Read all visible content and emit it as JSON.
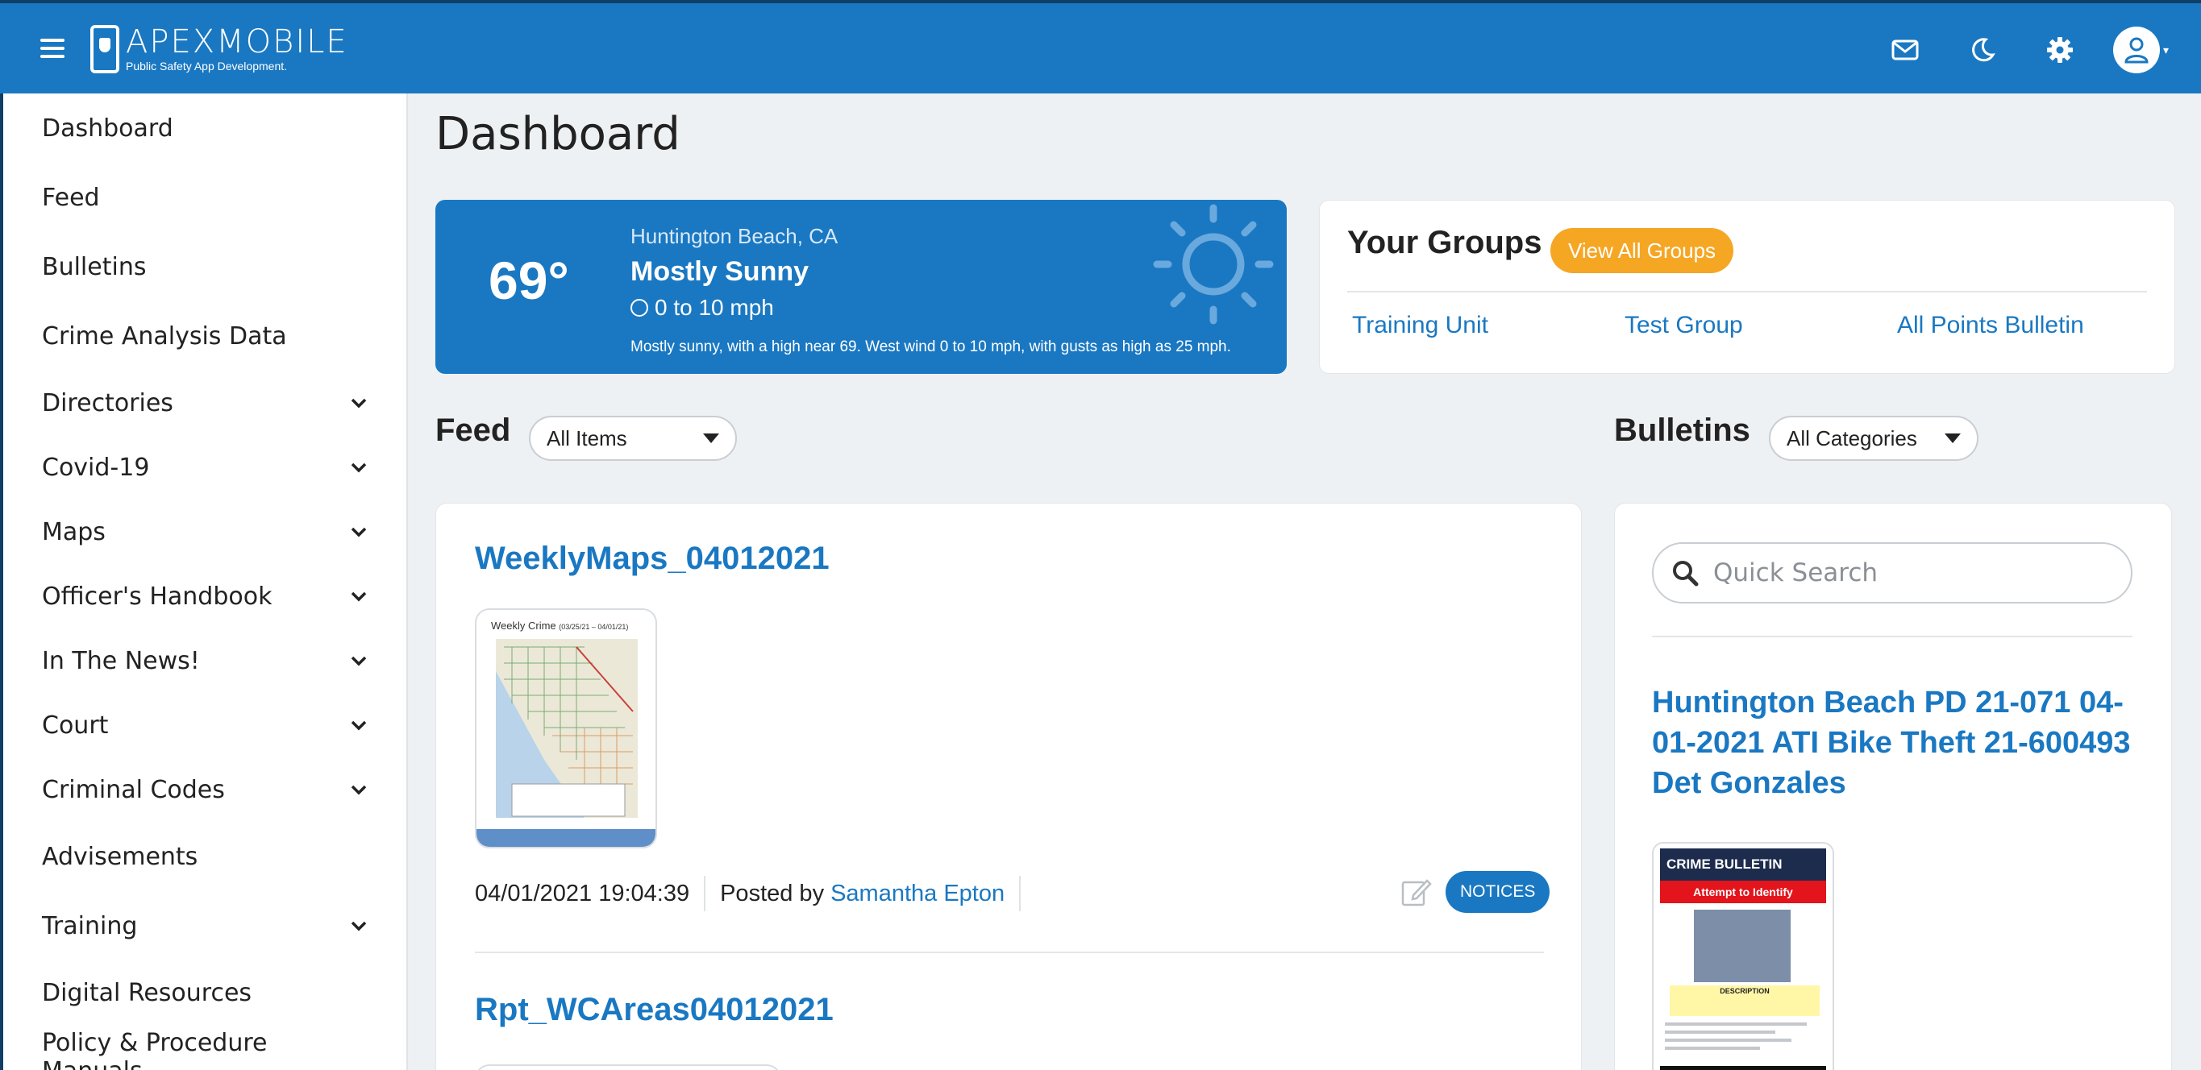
{
  "header": {
    "logo_name": "APEXMOBILE",
    "logo_tagline": "Public Safety App Development."
  },
  "sidebar": {
    "items": [
      {
        "label": "Dashboard",
        "expandable": false
      },
      {
        "label": "Feed",
        "expandable": false
      },
      {
        "label": "Bulletins",
        "expandable": false
      },
      {
        "label": "Crime Analysis Data",
        "expandable": false
      },
      {
        "label": "Directories",
        "expandable": true
      },
      {
        "label": "Covid-19",
        "expandable": true
      },
      {
        "label": "Maps",
        "expandable": true
      },
      {
        "label": "Officer's Handbook",
        "expandable": true
      },
      {
        "label": "In The News!",
        "expandable": true
      },
      {
        "label": "Court",
        "expandable": true
      },
      {
        "label": "Criminal Codes",
        "expandable": true
      },
      {
        "label": "Advisements",
        "expandable": false
      },
      {
        "label": "Training",
        "expandable": true
      },
      {
        "label": "Digital Resources",
        "expandable": false
      },
      {
        "label": "Policy & Procedure Manuals",
        "expandable": false
      }
    ]
  },
  "page": {
    "title": "Dashboard"
  },
  "weather": {
    "temperature": "69°",
    "location": "Huntington Beach, CA",
    "condition": "Mostly Sunny",
    "wind": "0 to 10 mph",
    "description": "Mostly sunny, with a high near 69. West wind 0 to 10 mph, with gusts as high as 25 mph."
  },
  "groups": {
    "title": "Your Groups",
    "view_all_label": "View All Groups",
    "links": [
      "Training Unit",
      "Test Group",
      "All Points Bulletin"
    ]
  },
  "feed": {
    "label": "Feed",
    "filter_value": "All Items",
    "posts": [
      {
        "title": "WeeklyMaps_04012021",
        "thumb_title": "Weekly Crime",
        "thumb_range": "(03/25/21 – 04/01/21)",
        "timestamp": "04/01/2021 19:04:39",
        "posted_by_label": "Posted by",
        "author": "Samantha Epton",
        "tag": "NOTICES"
      },
      {
        "title": "Rpt_WCAreas04012021"
      }
    ]
  },
  "bulletins": {
    "label": "Bulletins",
    "filter_value": "All Categories",
    "search_placeholder": "Quick Search",
    "item": {
      "title": "Huntington Beach PD 21-071 04-01-2021 ATI Bike Theft 21-600493 Det Gonzales",
      "thumb_header": "CRIME BULLETIN",
      "thumb_banner": "Attempt to Identify",
      "thumb_desc": "DESCRIPTION"
    }
  },
  "colors": {
    "brand_blue": "#1a78c2",
    "accent_orange": "#f5a623",
    "background": "#eef1f3"
  },
  "icons": {
    "menu": "hamburger-icon",
    "mail": "mail-icon",
    "theme": "moon-icon",
    "settings": "gear-icon",
    "user": "user-icon"
  }
}
